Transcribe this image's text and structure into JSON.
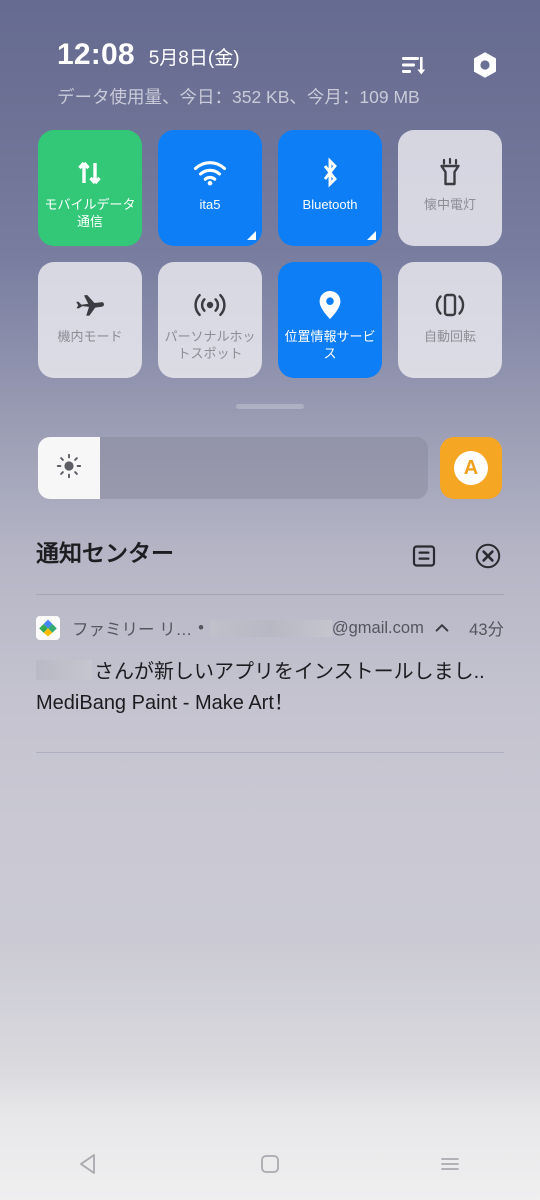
{
  "statusbar": {
    "time": "12:08",
    "date": "5月8日(金)",
    "data_usage": "データ使用量、今日：352 KB、今月：109 MB",
    "edit_icon": "sort-lines-down-icon",
    "settings_icon": "hex-gear-icon"
  },
  "quick_settings": {
    "tiles": [
      {
        "label": "モバイルデータ通信",
        "icon": "mobile-data-icon",
        "state": "on",
        "color": "#32c878",
        "expandable": false,
        "name": "tile-mobile-data"
      },
      {
        "label": "ita5",
        "icon": "wifi-icon",
        "state": "on",
        "color": "#0d7ef5",
        "expandable": true,
        "name": "tile-wifi"
      },
      {
        "label": "Bluetooth",
        "icon": "bluetooth-icon",
        "state": "on",
        "color": "#0d7ef5",
        "expandable": true,
        "name": "tile-bluetooth"
      },
      {
        "label": "懐中電灯",
        "icon": "flashlight-icon",
        "state": "off",
        "color": "#ebebf0",
        "expandable": false,
        "name": "tile-flashlight"
      },
      {
        "label": "機内モード",
        "icon": "airplane-icon",
        "state": "off",
        "color": "#ebebf0",
        "expandable": false,
        "name": "tile-airplane-mode"
      },
      {
        "label": "パーソナルホットスポット",
        "icon": "hotspot-icon",
        "state": "off",
        "color": "#ebebf0",
        "expandable": false,
        "name": "tile-hotspot"
      },
      {
        "label": "位置情報サービス",
        "icon": "location-pin-icon",
        "state": "on",
        "color": "#0d7ef5",
        "expandable": false,
        "name": "tile-location"
      },
      {
        "label": "自動回転",
        "icon": "auto-rotate-icon",
        "state": "off",
        "color": "#ebebf0",
        "expandable": false,
        "name": "tile-auto-rotate"
      }
    ]
  },
  "brightness": {
    "level_percent": 16,
    "slider_icon": "brightness-sun-icon",
    "auto_label": "A",
    "auto_color": "#f5a623"
  },
  "notification_center": {
    "title": "通知センター",
    "manage_icon": "notification-settings-icon",
    "clear_icon": "clear-all-icon",
    "notifications": [
      {
        "app_icon": "family-link-icon",
        "app_name": "ファミリー リ…",
        "separator": "•",
        "email_domain": "@gmail.com",
        "collapse_icon": "chevron-up-icon",
        "time": "43分",
        "title_suffix": "さんが新しいアプリをインストールしまし..",
        "body": "MediBang Paint - Make Art！"
      }
    ]
  },
  "navbar": {
    "back": "back-icon",
    "home": "home-icon",
    "recents": "recents-icon"
  }
}
